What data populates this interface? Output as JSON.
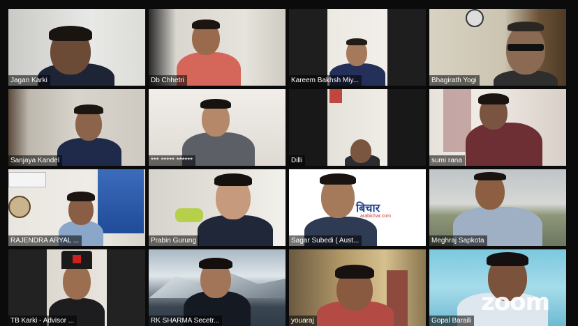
{
  "participants": [
    {
      "name": "Jagan Karki"
    },
    {
      "name": "Db Chhetri"
    },
    {
      "name": "Kareem Bakhsh Miy..."
    },
    {
      "name": "Bhagirath Yogi"
    },
    {
      "name": "Sanjaya Kandel"
    },
    {
      "name": "*** ***** ******"
    },
    {
      "name": "Dilli"
    },
    {
      "name": "sumi rana"
    },
    {
      "name": "RAJENDRA ARYAL ..."
    },
    {
      "name": "Prabin Gurung"
    },
    {
      "name": "Sagar Subedi ( Aust..."
    },
    {
      "name": "Meghraj Sapkota"
    },
    {
      "name": "TB Karki - Advisor ..."
    },
    {
      "name": "RK SHARMA Secetr..."
    },
    {
      "name": "youaraj"
    },
    {
      "name": "Gopal Baraili"
    }
  ],
  "banner": {
    "logo": "बिचार",
    "url": "arabichar.com"
  },
  "watermark": "zoom",
  "colors": {
    "active_speaker_border": "#f2c200",
    "background": "#0b0b0b"
  }
}
